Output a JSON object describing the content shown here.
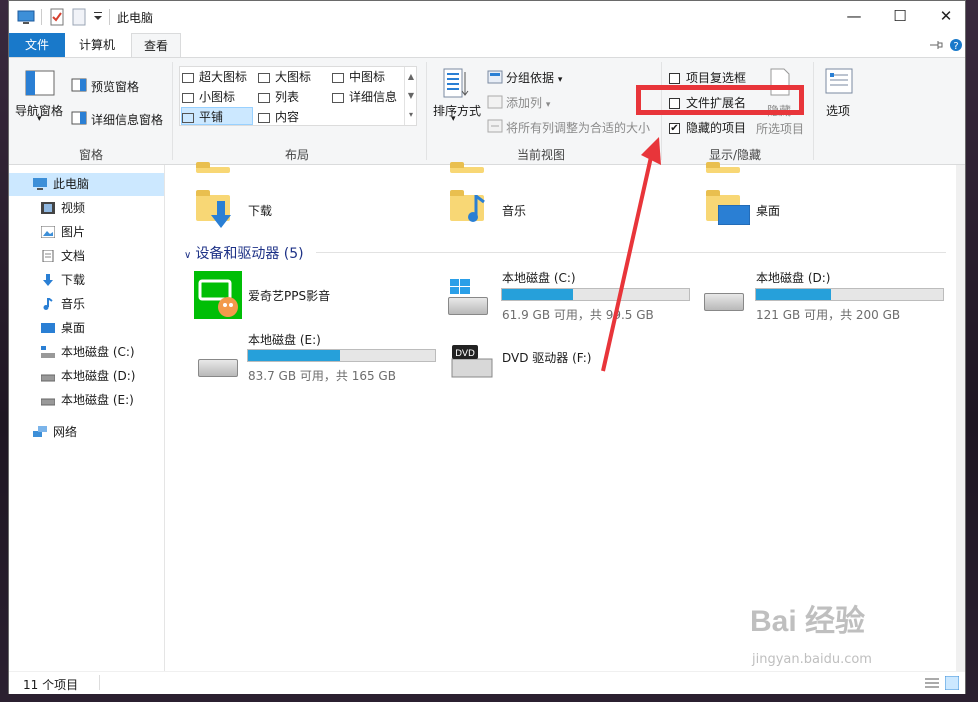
{
  "window": {
    "title": "此电脑",
    "minimize": "—",
    "maximize": "☐",
    "close": "✕"
  },
  "tabs": [
    {
      "label": "文件"
    },
    {
      "label": "计算机"
    },
    {
      "label": "查看"
    }
  ],
  "ribbon": {
    "panes": {
      "nav_pane": "导航窗格",
      "preview_pane": "预览窗格",
      "details_pane": "详细信息窗格",
      "group_label": "窗格"
    },
    "layout": {
      "items": [
        "超大图标",
        "大图标",
        "中图标",
        "小图标",
        "列表",
        "详细信息",
        "平铺",
        "内容"
      ],
      "group_label": "布局"
    },
    "current_view": {
      "sort_by": "排序方式",
      "group_by": "分组依据",
      "add_columns": "添加列",
      "size_columns": "将所有列调整为合适的大小",
      "group_label": "当前视图"
    },
    "show_hide": {
      "item_checkboxes": "项目复选框",
      "file_extensions": "文件扩展名",
      "hidden_items": "隐藏的项目",
      "hide_selected": "隐藏",
      "selected_items": "所选项目",
      "group_label": "显示/隐藏",
      "item_checkboxes_checked": false,
      "file_extensions_checked": false,
      "hidden_items_checked": true
    },
    "options": "选项"
  },
  "nav": {
    "items": [
      {
        "label": "此电脑"
      },
      {
        "label": "视频"
      },
      {
        "label": "图片"
      },
      {
        "label": "文档"
      },
      {
        "label": "下载"
      },
      {
        "label": "音乐"
      },
      {
        "label": "桌面"
      },
      {
        "label": "本地磁盘 (C:)"
      },
      {
        "label": "本地磁盘 (D:)"
      },
      {
        "label": "本地磁盘 (E:)"
      },
      {
        "label": "网络"
      }
    ]
  },
  "folders": [
    {
      "label": "下载"
    },
    {
      "label": "音乐"
    },
    {
      "label": "桌面"
    }
  ],
  "devices": {
    "header": "设备和驱动器 (5)",
    "items": [
      {
        "label": "爱奇艺PPS影音",
        "icon": "iqiyi-icon"
      },
      {
        "label": "本地磁盘 (C:)",
        "usage": "61.9 GB 可用，共 99.5 GB",
        "used_fraction": 0.38
      },
      {
        "label": "本地磁盘 (D:)",
        "usage": "121 GB 可用，共 200 GB",
        "used_fraction": 0.4
      },
      {
        "label": "本地磁盘 (E:)",
        "usage": "83.7 GB 可用，共 165 GB",
        "used_fraction": 0.49
      },
      {
        "label": "DVD 驱动器 (F:)",
        "icon": "dvd-drive-icon"
      }
    ]
  },
  "status": {
    "count": "11 个项目"
  },
  "watermark": {
    "brand": "Bai 经验",
    "url": "jingyan.baidu.com"
  },
  "colors": {
    "accent": "#1979ca",
    "bar_fill": "#26a0da",
    "annotation": "#e8353a"
  }
}
